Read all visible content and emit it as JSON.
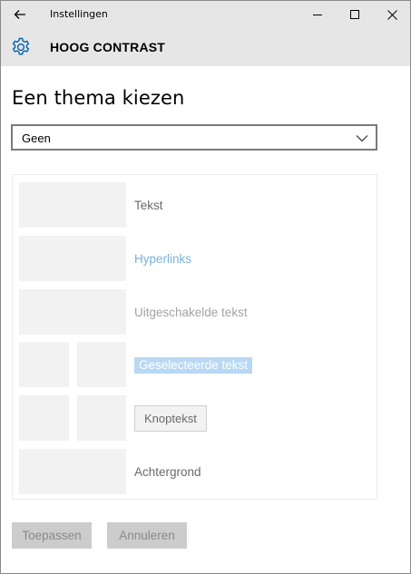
{
  "window": {
    "app_title": "Instellingen",
    "controls": {
      "minimize": "minimize-icon",
      "maximize": "maximize-icon",
      "close": "close-icon"
    }
  },
  "header": {
    "icon": "gear-icon",
    "title": "HOOG CONTRAST"
  },
  "main": {
    "section_title": "Een thema kiezen",
    "theme_select": {
      "selected": "Geen",
      "icon": "chevron-down-icon"
    },
    "preview_rows": {
      "text": "Tekst",
      "hyperlinks": "Hyperlinks",
      "disabled_text": "Uitgeschakelde tekst",
      "selected_text": "Geselecteerde tekst",
      "button_text": "Knoptekst",
      "background": "Achtergrond"
    },
    "buttons": {
      "apply": "Toepassen",
      "cancel": "Annuleren"
    }
  },
  "colors": {
    "titlebar_bg": "#e6e6e6",
    "accent": "#0063b1",
    "hyperlink": "#7ab1dc",
    "selected_bg": "#b9d8f3",
    "swatch": "#f2f2f2",
    "button_disabled": "#cccccc"
  }
}
